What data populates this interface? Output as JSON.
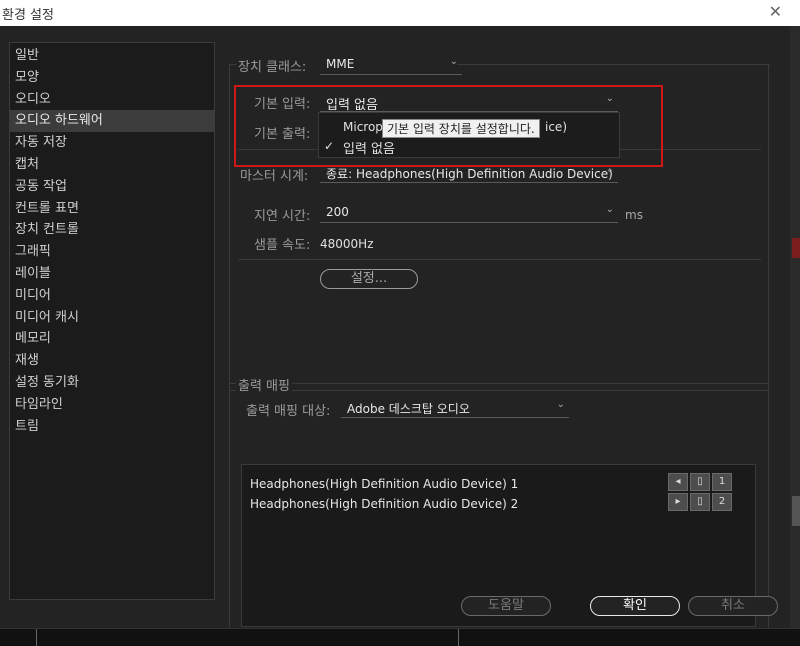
{
  "window": {
    "title": "환경 설정",
    "close_glyph": "✕"
  },
  "sidebar": {
    "items": [
      {
        "label": "일반"
      },
      {
        "label": "모양"
      },
      {
        "label": "오디오"
      },
      {
        "label": "오디오 하드웨어",
        "selected": true
      },
      {
        "label": "자동 저장"
      },
      {
        "label": "캡처"
      },
      {
        "label": "공동 작업"
      },
      {
        "label": "컨트롤 표면"
      },
      {
        "label": "장치 컨트롤"
      },
      {
        "label": "그래픽"
      },
      {
        "label": "레이블"
      },
      {
        "label": "미디어"
      },
      {
        "label": "미디어 캐시"
      },
      {
        "label": "메모리"
      },
      {
        "label": "재생"
      },
      {
        "label": "설정 동기화"
      },
      {
        "label": "타임라인"
      },
      {
        "label": "트림"
      }
    ]
  },
  "device": {
    "class_label": "장치 클래스:",
    "class_value": "MME",
    "default_input_label": "기본 입력:",
    "default_input_value": "입력 없음",
    "default_output_label": "기본 출력:",
    "master_clock_label": "마스터 시계:",
    "master_clock_value": "종료: Headphones(High Definition Audio Device)",
    "latency_label": "지연 시간:",
    "latency_value": "200",
    "latency_unit": "ms",
    "sample_rate_label": "샘플 속도:",
    "sample_rate_value": "48000Hz",
    "settings_button": "설정..."
  },
  "popup": {
    "item1_prefix": "Microph",
    "item1_suffix": "ice)",
    "item2": "입력 없음",
    "check_glyph": "✓",
    "tooltip": "기본 입력 장치를 설정합니다."
  },
  "output": {
    "group_label": "출력 매핑",
    "target_label": "출력 매핑 대상:",
    "target_value": "Adobe 데스크탑 오디오",
    "rows": [
      {
        "label": "Headphones(High Definition Audio Device) 1",
        "channel": "1"
      },
      {
        "label": "Headphones(High Definition Audio Device) 2",
        "channel": "2"
      }
    ]
  },
  "footer": {
    "help": "도움말",
    "ok": "확인",
    "cancel": "취소"
  },
  "icons": {
    "chevron": "⌄",
    "speaker_left": "◂",
    "speaker_right": "▸"
  },
  "colors": {
    "highlight": "#d01818"
  }
}
